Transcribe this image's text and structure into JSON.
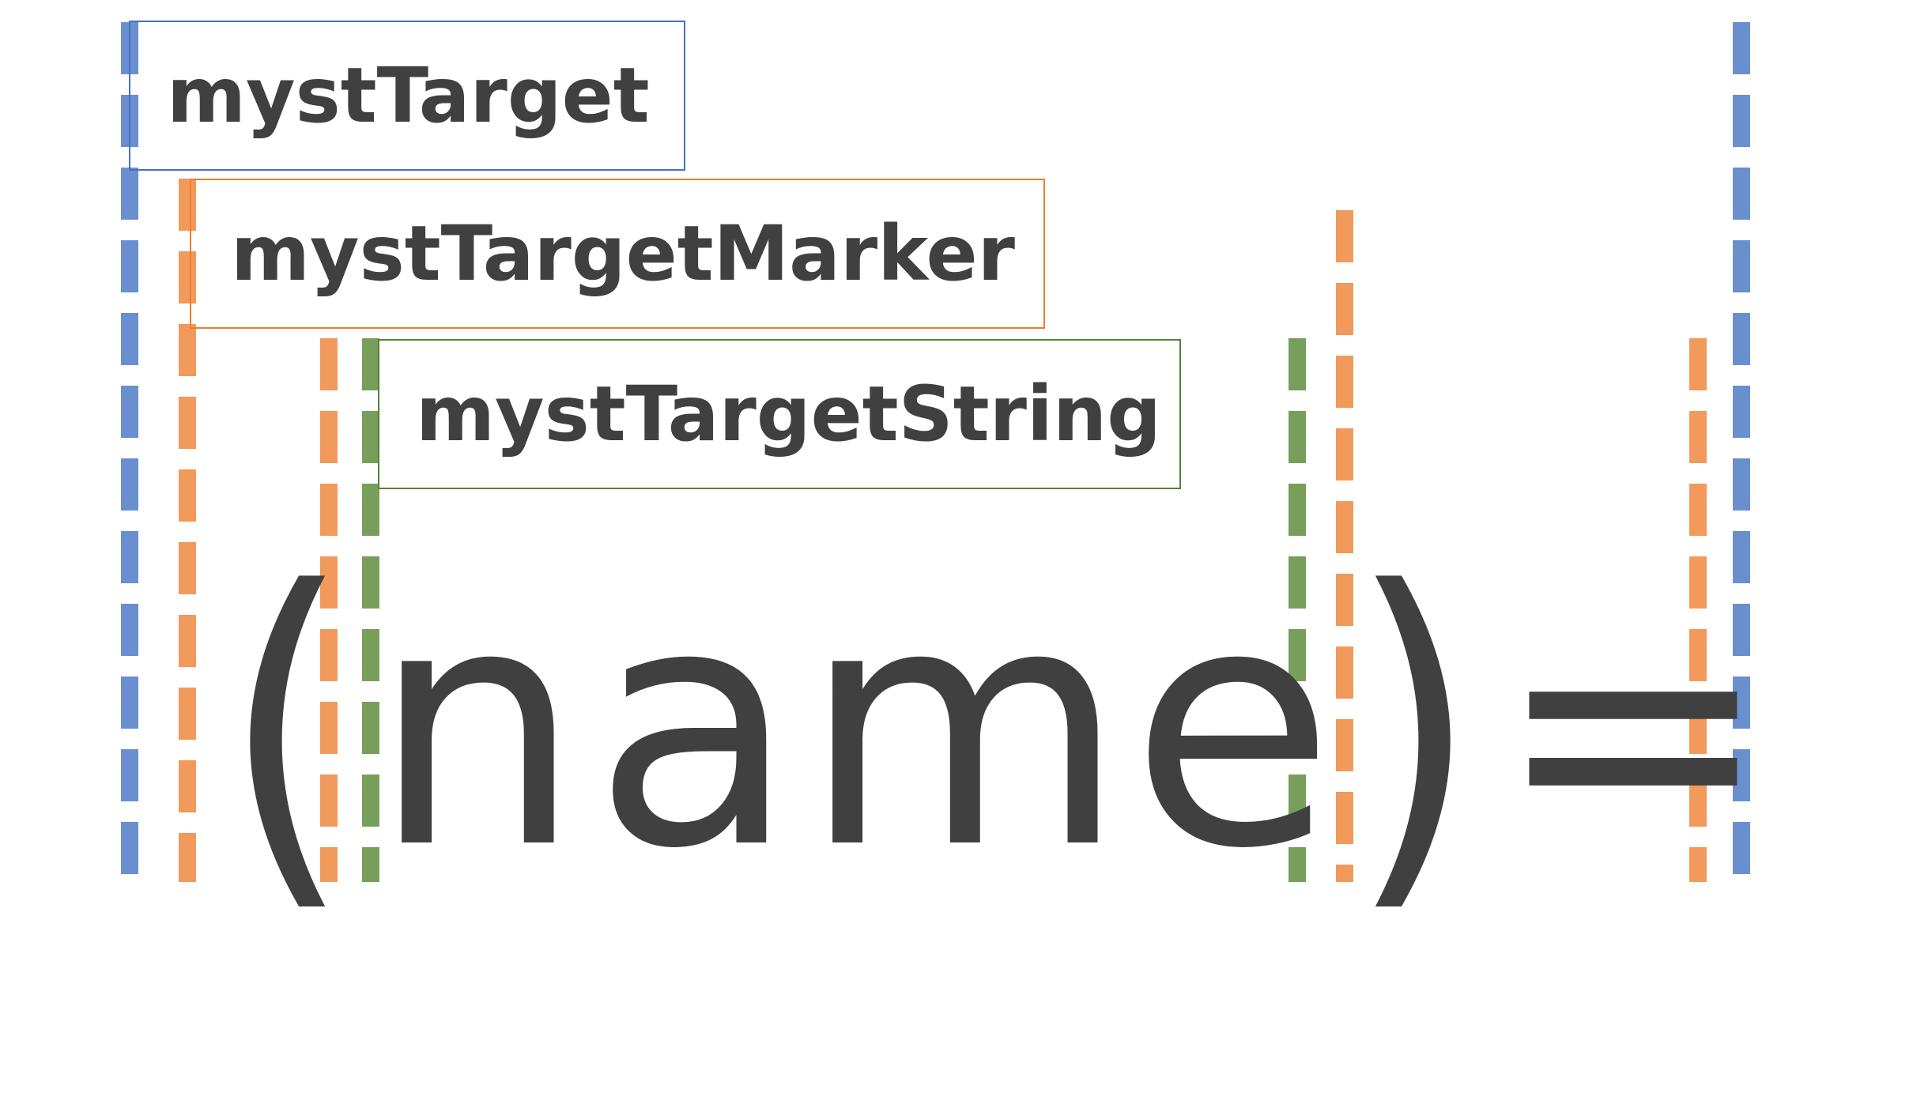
{
  "labels": {
    "target": "mystTarget",
    "marker": "mystTargetMarker",
    "string": "mystTargetString"
  },
  "syntax": {
    "open_paren": "(",
    "chars": [
      "n",
      "a",
      "m",
      "e"
    ],
    "close_paren": ")",
    "equals": "="
  },
  "colors": {
    "target": "#4472c4",
    "target_dash": "#6a8fce",
    "marker": "#ed7d31",
    "marker_dash": "#f19a5c",
    "string": "#548235",
    "string_dash": "#789e5c",
    "text": "#404040"
  }
}
